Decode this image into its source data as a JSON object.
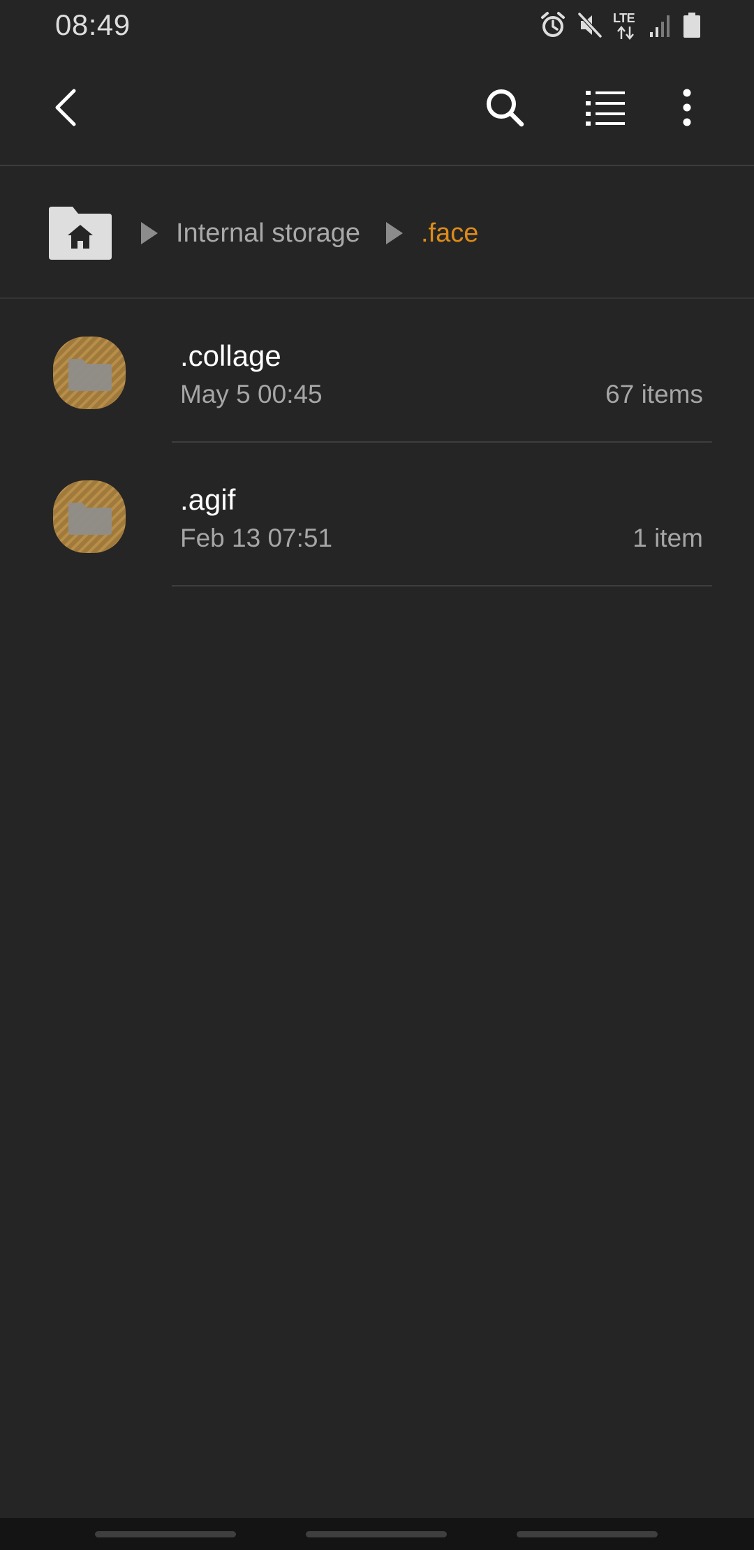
{
  "status_bar": {
    "time": "08:49",
    "network_label": "LTE",
    "icons": [
      "alarm-icon",
      "mute-icon",
      "lte-data-icon",
      "signal-icon",
      "battery-icon"
    ]
  },
  "app_bar": {
    "actions": [
      "back-icon",
      "search-icon",
      "list-view-icon",
      "more-options-icon"
    ]
  },
  "breadcrumb": {
    "home_icon": "home-folder-icon",
    "items": [
      {
        "label": "Internal storage"
      },
      {
        "label": ".face"
      }
    ]
  },
  "files": [
    {
      "name": ".collage",
      "date": "May 5 00:45",
      "count": "67 items",
      "icon": "hidden-folder-icon"
    },
    {
      "name": ".agif",
      "date": "Feb 13 07:51",
      "count": "1 item",
      "icon": "hidden-folder-icon"
    }
  ],
  "colors": {
    "background": "#252525",
    "accent": "#dd8b1a",
    "folder_icon_bg": "#a07a3a",
    "secondary_text": "#a6a6a6",
    "nav_bar": "#141414"
  }
}
